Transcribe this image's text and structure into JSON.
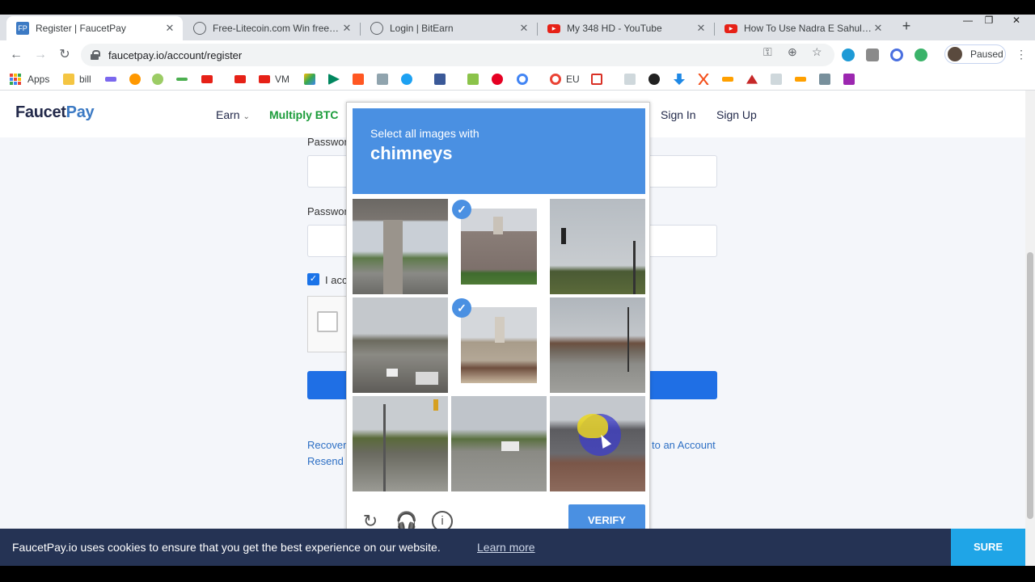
{
  "browser": {
    "tabs": [
      {
        "title": "Register | FaucetPay",
        "active": true,
        "icon": "faucetpay-favicon"
      },
      {
        "title": "Free-Litecoin.com Win free Lite",
        "active": false,
        "icon": "globe-favicon"
      },
      {
        "title": "Login | BitEarn",
        "active": false,
        "icon": "globe-favicon"
      },
      {
        "title": "My 348 HD - YouTube",
        "active": false,
        "icon": "youtube-favicon"
      },
      {
        "title": "How To Use Nadra E Sahulat A",
        "active": false,
        "icon": "youtube-favicon"
      }
    ],
    "url": "faucetpay.io/account/register",
    "profile_status": "Paused",
    "bookmarks": {
      "apps_label": "Apps",
      "bill_label": "bill",
      "vm_label": "VM",
      "eu_label": "EU"
    }
  },
  "site": {
    "logo_part1": "Faucet",
    "logo_part2": "Pay",
    "nav": {
      "earn": "Earn",
      "multiply": "Multiply BTC",
      "signin": "Sign In",
      "signup": "Sign Up"
    },
    "form": {
      "password_label": "Passwor",
      "password_repeat_label": "Passwor",
      "terms_label": "I acc",
      "recover_link": "Recover",
      "resend_link": "Resend",
      "account_link": "to an Account"
    }
  },
  "captcha": {
    "instruction": "Select all images with",
    "target": "chimneys",
    "verify_label": "VERIFY",
    "tiles": [
      {
        "subject": "overpass",
        "selected": false
      },
      {
        "subject": "house-chimney",
        "selected": true
      },
      {
        "subject": "traffic-light",
        "selected": false
      },
      {
        "subject": "road",
        "selected": false
      },
      {
        "subject": "house-roof",
        "selected": true
      },
      {
        "subject": "parking-lot",
        "selected": false
      },
      {
        "subject": "intersection",
        "selected": false
      },
      {
        "subject": "street-cars",
        "selected": false
      },
      {
        "subject": "building",
        "selected": false
      }
    ]
  },
  "cookie": {
    "text": "FaucetPay.io uses cookies to ensure that you get the best experience on our website.",
    "learn_more": "Learn more",
    "accept": "SURE"
  }
}
